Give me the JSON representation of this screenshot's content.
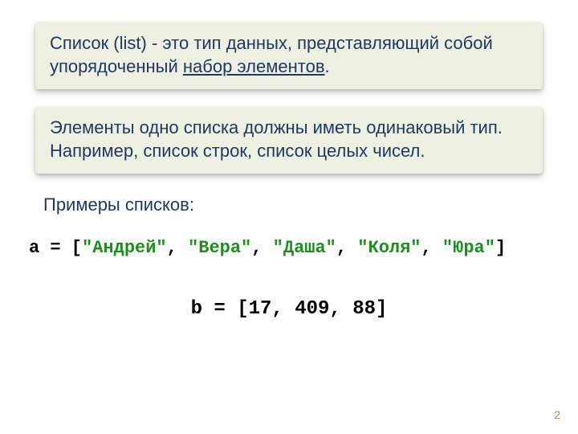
{
  "callout1": {
    "prefix": "Список (list) - это тип данных, представляющий собой упорядоченный ",
    "underlined": "набор элементов",
    "suffix": "."
  },
  "callout2": {
    "text": "Элементы одно списка должны иметь одинаковый тип. Например, список строк, список целых чисел."
  },
  "examples_title": "Примеры списков:",
  "code_a": {
    "lead": "a = [",
    "s1": "\"Андрей\"",
    "c1": ", ",
    "s2": "\"Вера\"",
    "c2": ", ",
    "s3": "\"Даша\"",
    "c3": ", ",
    "s4": "\"Коля\"",
    "c4": ", ",
    "s5": "\"Юра\"",
    "tail": "]"
  },
  "code_b": "b = [17, 409, 88]",
  "page_number": "2"
}
